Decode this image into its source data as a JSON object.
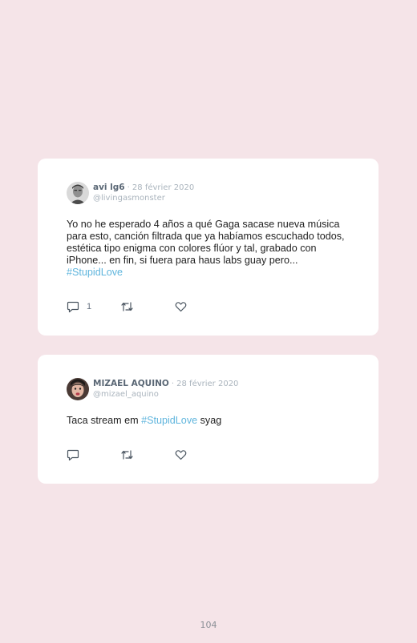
{
  "posts": [
    {
      "author": "avi lg6",
      "separator": "·",
      "date": "28 février 2020",
      "handle": "@livingasmonster",
      "text_before": "Yo no he esperado 4 años a qué Gaga sacase nueva música para esto, canción filtrada que ya habíamos escuchado todos, estética tipo enigma con colores flúor y tal, grabado con iPhone... en fin, si fuera para haus labs guay pero... ",
      "hashtag": "#StupidLove",
      "text_after": "",
      "reply_count": "1",
      "icons": {
        "reply": "comment-icon",
        "retweet": "retweet-icon",
        "like": "heart-icon"
      }
    },
    {
      "author": "MIZAEL AQUINO",
      "separator": "·",
      "date": "28 février 2020",
      "handle": "@mizael_aquino",
      "text_before": "Taca stream em ",
      "hashtag": "#StupidLove",
      "text_after": " syag",
      "reply_count": "",
      "icons": {
        "reply": "comment-icon",
        "retweet": "retweet-icon",
        "like": "heart-icon"
      }
    }
  ],
  "page_number": "104",
  "colors": {
    "background": "#f5e4e8",
    "card": "#ffffff",
    "hashtag": "#5fb5dd",
    "muted": "#aab4bd",
    "name": "#5a6775"
  }
}
